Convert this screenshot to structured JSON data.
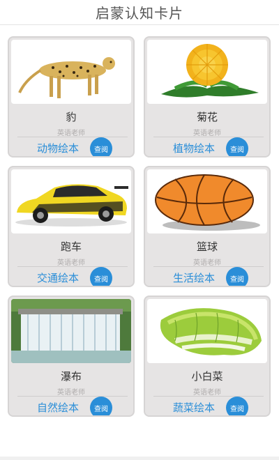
{
  "app": {
    "title": "启蒙认知卡片"
  },
  "cards": [
    {
      "name": "豹",
      "teacher": "英语老师",
      "book": "动物绘本",
      "button": "查阅",
      "image": "cheetah-image"
    },
    {
      "name": "菊花",
      "teacher": "英语老师",
      "book": "植物绘本",
      "button": "查阅",
      "image": "chrysanthemum-image"
    },
    {
      "name": "跑车",
      "teacher": "英语老师",
      "book": "交通绘本",
      "button": "查阅",
      "image": "sports-car-image"
    },
    {
      "name": "篮球",
      "teacher": "英语老师",
      "book": "生活绘本",
      "button": "查阅",
      "image": "basketball-image"
    },
    {
      "name": "瀑布",
      "teacher": "英语老师",
      "book": "自然绘本",
      "button": "查阅",
      "image": "waterfall-image"
    },
    {
      "name": "小白菜",
      "teacher": "英语老师",
      "book": "蔬菜绘本",
      "button": "查阅",
      "image": "cabbage-image"
    }
  ],
  "colors": {
    "accent": "#2a8ed8",
    "card_bg": "#e6e4e4",
    "title": "#555555"
  }
}
